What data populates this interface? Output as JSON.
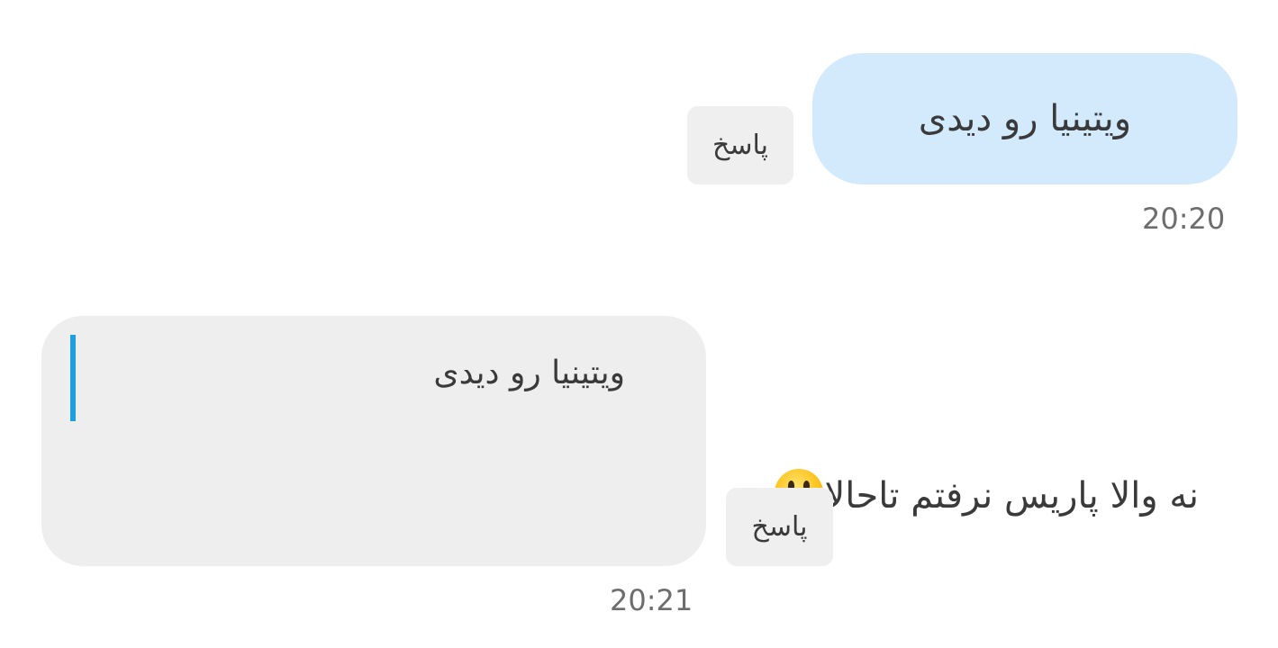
{
  "messages": [
    {
      "direction": "outgoing",
      "text": "ویتینیا رو دیدی",
      "time": "20:20",
      "reply_label": "پاسخ",
      "bubble_color": "#d3eafd"
    },
    {
      "direction": "incoming",
      "quoted_text": "ویتینیا رو دیدی",
      "text": "نه والا پاریس نرفتم تاحالا",
      "emoji": "grinning-face-icon",
      "time": "20:21",
      "reply_label": "پاسخ",
      "bubble_color": "#eeeeee",
      "quote_bar_color": "#1e9fe0"
    }
  ]
}
